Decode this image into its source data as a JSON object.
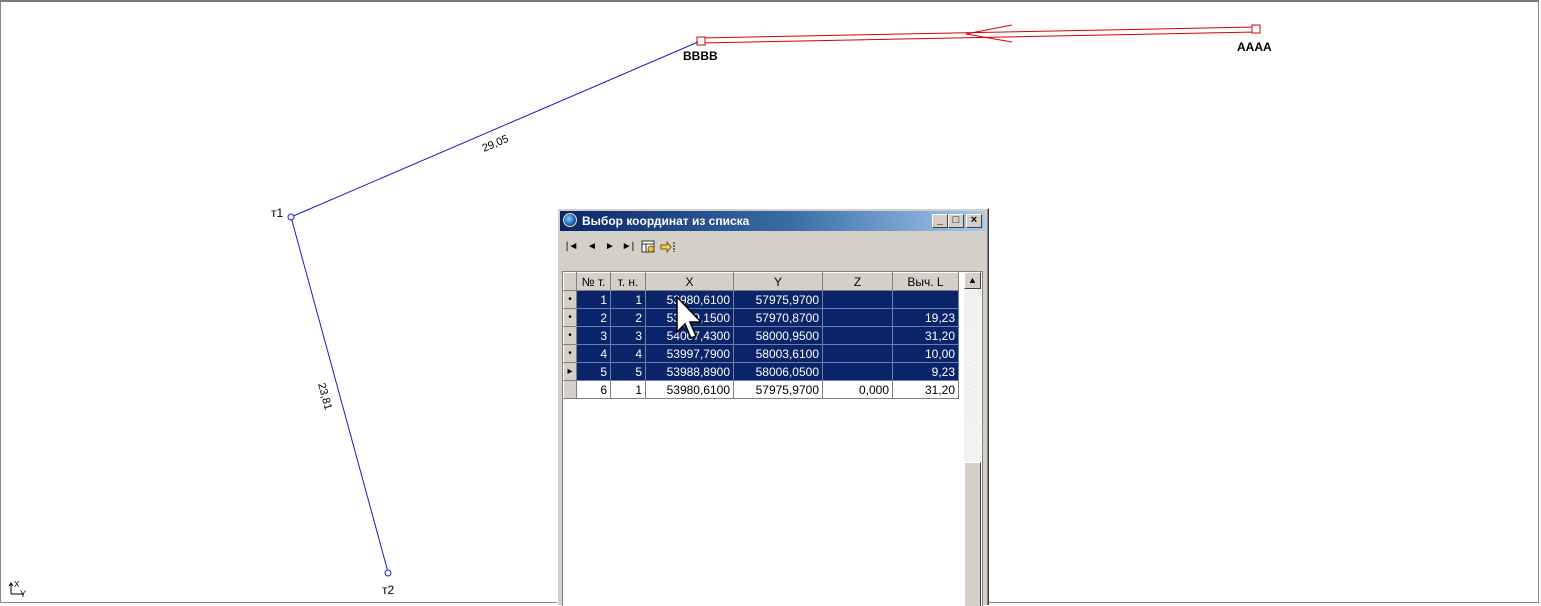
{
  "drawing": {
    "points": [
      {
        "label": "AAAA"
      },
      {
        "label": "BBBB"
      },
      {
        "label": "т1"
      },
      {
        "label": "т2"
      }
    ],
    "segment_labels": [
      "29,05",
      "23,81"
    ],
    "colors": {
      "boundary": "#d80000",
      "traverse": "#1a1ac8"
    }
  },
  "axis_icon": {
    "x": "X",
    "y": "Y"
  },
  "dialog": {
    "title": "Выбор координат из списка",
    "caption_buttons": {
      "minimize": "_",
      "maximize": "□",
      "close": "×"
    },
    "toolbar": {
      "first": "|◄",
      "prev": "◄",
      "next": "►",
      "last": "►|"
    },
    "columns": [
      "№ т.",
      "т. н.",
      "X",
      "Y",
      "Z",
      "Выч. L"
    ],
    "rows": [
      {
        "indicator": "•",
        "n": "1",
        "tn": "1",
        "x": "53980,6100",
        "y": "57975,9700",
        "z": "",
        "l": ""
      },
      {
        "indicator": "•",
        "n": "2",
        "tn": "2",
        "x": "53989,1500",
        "y": "57970,8700",
        "z": "",
        "l": "19,23"
      },
      {
        "indicator": "•",
        "n": "3",
        "tn": "3",
        "x": "54007,4300",
        "y": "58000,9500",
        "z": "",
        "l": "31,20"
      },
      {
        "indicator": "•",
        "n": "4",
        "tn": "4",
        "x": "53997,7900",
        "y": "58003,6100",
        "z": "",
        "l": "10,00"
      },
      {
        "indicator": "▸",
        "n": "5",
        "tn": "5",
        "x": "53988,8900",
        "y": "58006,0500",
        "z": "",
        "l": "9,23"
      },
      {
        "indicator": "",
        "n": "6",
        "tn": "1",
        "x": "53980,6100",
        "y": "57975,9700",
        "z": "0,000",
        "l": "31,20"
      }
    ],
    "selected_rows": 5,
    "scrollbar_up": "▲"
  }
}
